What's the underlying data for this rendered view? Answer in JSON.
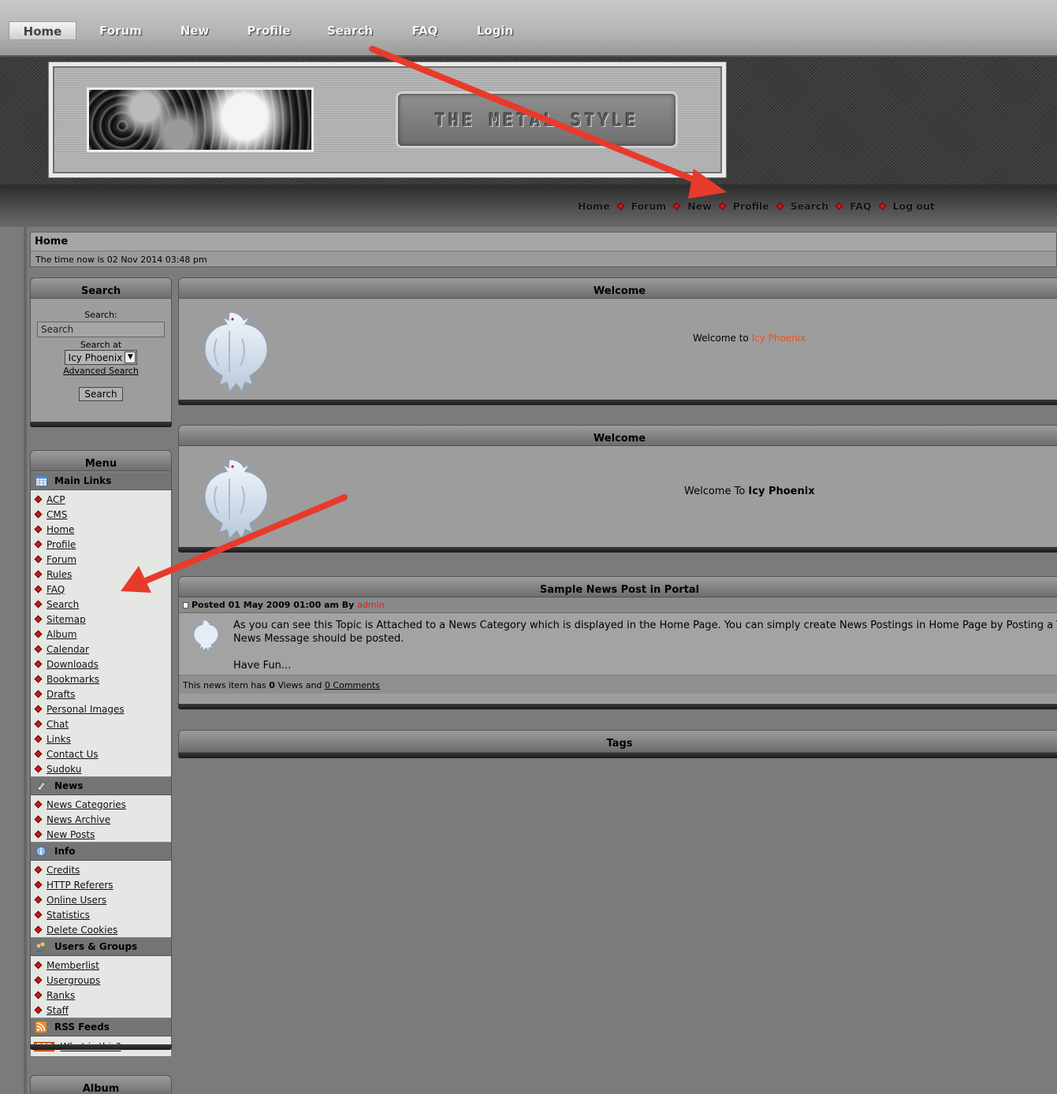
{
  "top_nav": {
    "tabs": [
      "Home",
      "Forum",
      "New",
      "Profile",
      "Search",
      "FAQ",
      "Login"
    ]
  },
  "header": {
    "logo_text": "THE METAL STYLE"
  },
  "sub_nav": {
    "links": [
      "Home",
      "Forum",
      "New",
      "Profile",
      "Search",
      "FAQ",
      "Log out"
    ]
  },
  "page": {
    "breadcrumb": "Home",
    "time_text": "The time now is 02 Nov 2014 03:48 pm"
  },
  "search_panel": {
    "title": "Search",
    "search_label": "Search:",
    "input_value": "Search",
    "search_at_label": "Search at",
    "select_value": "Icy Phoenix",
    "advanced_link": "Advanced Search",
    "button": "Search"
  },
  "menu_panel": {
    "title": "Menu",
    "categories": {
      "main": "Main Links",
      "news": "News",
      "info": "Info",
      "users": "Users & Groups",
      "rss": "RSS Feeds"
    },
    "main_links": [
      "ACP",
      "CMS",
      "Home",
      "Profile",
      "Forum",
      "Rules",
      "FAQ",
      "Search",
      "Sitemap",
      "Album",
      "Calendar",
      "Downloads",
      "Bookmarks",
      "Drafts",
      "Personal Images",
      "Chat",
      "Links",
      "Contact Us",
      "Sudoku"
    ],
    "news_links": [
      "News Categories",
      "News Archive",
      "New Posts"
    ],
    "info_links": [
      "Credits",
      "HTTP Referers",
      "Online Users",
      "Statistics",
      "Delete Cookies"
    ],
    "users_links": [
      "Memberlist",
      "Usergroups",
      "Ranks",
      "Staff"
    ],
    "rss_badge": "RSS",
    "rss_link": "What is this?"
  },
  "album_panel": {
    "title": "Album"
  },
  "welcome1": {
    "title": "Welcome",
    "text_prefix": "Welcome to ",
    "text_highlight": "Icy Phoenix"
  },
  "welcome2": {
    "title": "Welcome",
    "text_prefix": "Welcome To ",
    "text_bold": "Icy Phoenix"
  },
  "news": {
    "title": "Sample News Post in Portal",
    "meta_posted": "Posted",
    "meta_date": "01 May 2009 01:00 am",
    "meta_by": "By",
    "meta_author": "admin",
    "body_line1": "As you can see this Topic is Attached to a News Category which is displayed in the Home Page. You can simply create News Postings in Home Page by Posting a Topic",
    "body_line2": "News Message should be posted.",
    "body_line3": "Have Fun...",
    "footer_prefix": "This news item has",
    "footer_views_count": "0",
    "footer_views": "Views and",
    "footer_comments": "0 Comments"
  },
  "tags_panel": {
    "title": "Tags"
  },
  "colors": {
    "accent_red": "#e83a2c",
    "highlight_orange": "#e8531b",
    "author_red": "#e11d1d",
    "diamond_red": "#c41a1a"
  }
}
